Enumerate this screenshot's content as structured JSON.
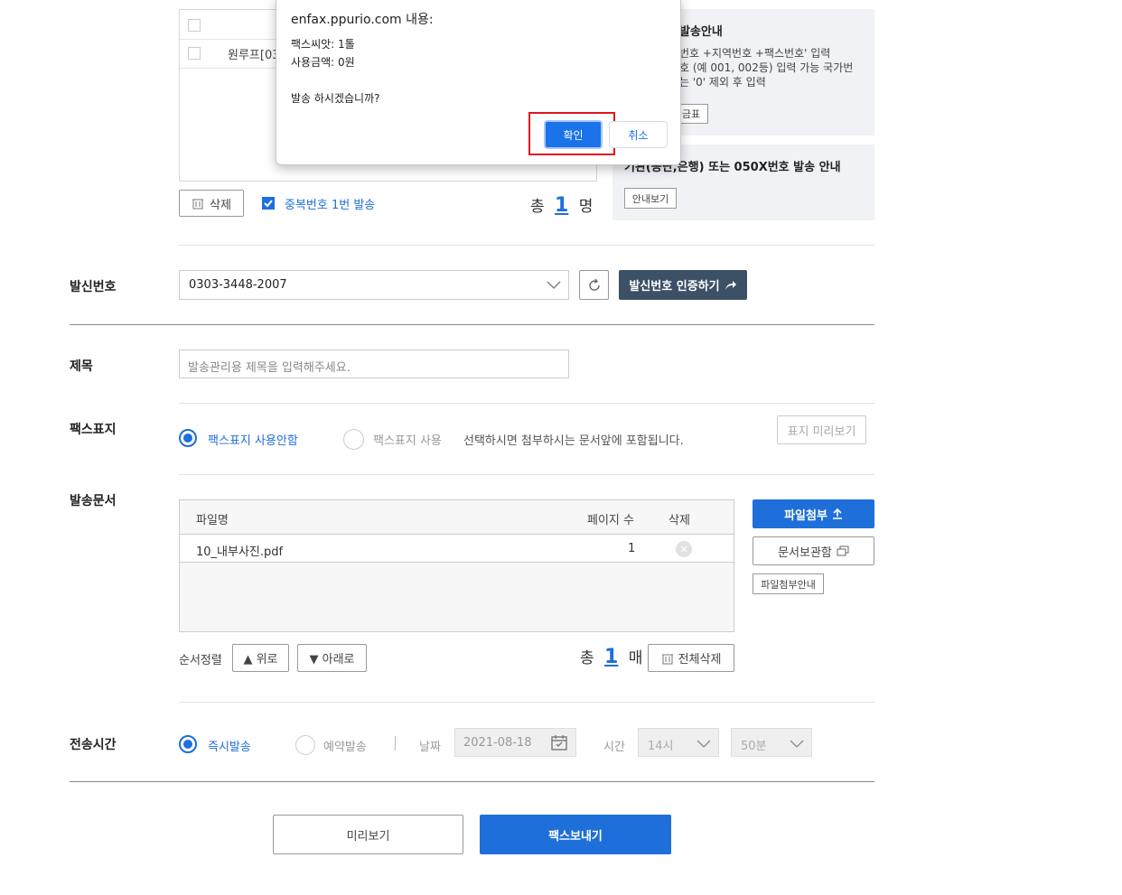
{
  "recipients": {
    "row1": "원루프[03",
    "delete_label": "삭제",
    "dup_label": "중복번호 1번 발송",
    "total_prefix": "총",
    "total_count": "1",
    "total_unit": "명"
  },
  "notice": {
    "title1": "발송안내",
    "line1": "번호 +지역번호 +팩스번호' 입력",
    "line2": "호 (예 001, 002등) 입력 가능 국가번",
    "line3": "는 '0' 제외 후 입력",
    "rate_btn": "금표",
    "title2": "기관(공단,은행) 또는 050X번호 발송 안내",
    "guide_btn": "안내보기"
  },
  "dialog": {
    "title": "enfax.ppurio.com 내용:",
    "line1": "팩스씨앗: 1톨",
    "line2": "사용금액: 0원",
    "question": "발송 하시겠습니까?",
    "ok": "확인",
    "cancel": "취소"
  },
  "sender": {
    "label": "발신번호",
    "value": "0303-3448-2007",
    "verify_btn": "발신번호 인증하기"
  },
  "subject": {
    "label": "제목",
    "placeholder": "발송관리용 제목을 입력해주세요."
  },
  "cover": {
    "label": "팩스표지",
    "opt_no": "팩스표지 사용안함",
    "opt_yes": "팩스표지 사용",
    "desc": "선택하시면 첨부하시는 문서앞에 포함됩니다.",
    "preview_btn": "표지 미리보기"
  },
  "docs": {
    "label": "발송문서",
    "col_name": "파일명",
    "col_pages": "페이지 수",
    "col_delete": "삭제",
    "files": [
      {
        "name": "10_내부사진.pdf",
        "pages": "1"
      }
    ],
    "attach_btn": "파일첨부",
    "storage_btn": "문서보관함",
    "attach_guide": "파일첨부안내",
    "sort_label": "순서정렬",
    "up_btn": "▲ 위로",
    "down_btn": "▼ 아래로",
    "total_prefix": "총",
    "total_count": "1",
    "total_unit": "매",
    "delete_all": "전체삭제"
  },
  "timing": {
    "label": "전송시간",
    "opt_now": "즉시발송",
    "opt_later": "예약발송",
    "date_label": "날짜",
    "date_value": "2021-08-18",
    "time_label": "시간",
    "hour_value": "14시",
    "minute_value": "50분"
  },
  "actions": {
    "preview": "미리보기",
    "send": "팩스보내기"
  },
  "colors": {
    "primary": "#1e6fd9",
    "dark_button": "#3d5166",
    "highlight": "#e0141e"
  }
}
